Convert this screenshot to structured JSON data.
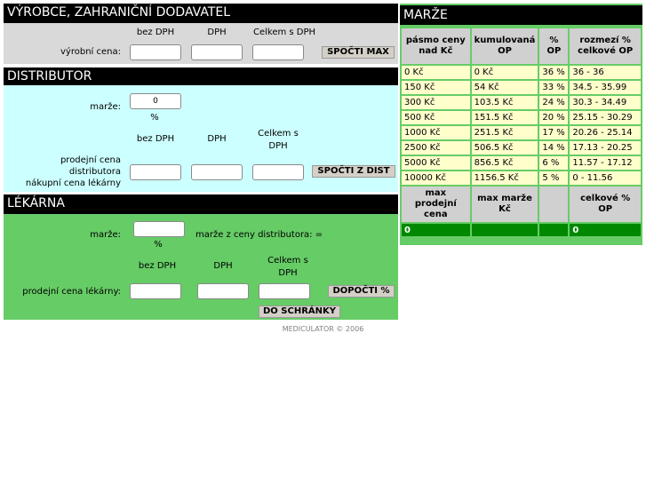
{
  "vyrobce": {
    "title": "VÝROBCE, ZAHRANIČNÍ DODAVATEL",
    "col_bez": "bez DPH",
    "col_dph": "DPH",
    "col_celkem": "Celkem s DPH",
    "row_label": "výrobní cena:",
    "button": "SPOČTI MAX",
    "values": {
      "bez": "",
      "dph": "",
      "celkem": ""
    }
  },
  "distributor": {
    "title": "DISTRIBUTOR",
    "marze_label": "marže:",
    "marze_value": "0",
    "percent": "%",
    "col_bez": "bez DPH",
    "col_dph": "DPH",
    "col_celkem": "Celkem s DPH",
    "row_label_1": "prodejní cena",
    "row_label_2": "distributora",
    "row_label_3": "nákupní cena lékárny",
    "button": "SPOČTI Z DIST",
    "values": {
      "bez": "",
      "dph": "",
      "celkem": ""
    }
  },
  "lekarna": {
    "title": "LÉKÁRNA",
    "marze_label": "marže:",
    "marze_value": "",
    "percent": "%",
    "marze_z_ceny": "marže z ceny distributora: =",
    "col_bez": "bez DPH",
    "col_dph": "DPH",
    "col_celkem": "Celkem s DPH",
    "row_label": "prodejní cena lékárny:",
    "button_dopocti": "DOPOČTI %",
    "button_schranky": "DO SCHRÁNKY",
    "values": {
      "bez": "",
      "dph": "",
      "celkem": ""
    }
  },
  "marze": {
    "title": "MARŽE",
    "headers": [
      "pásmo ceny nad Kč",
      "kumulovaná OP",
      "% OP",
      "rozmezí % celkové OP"
    ],
    "rows": [
      [
        "0 Kč",
        "0 Kč",
        "36 %",
        "36 - 36"
      ],
      [
        "150 Kč",
        "54 Kč",
        "33 %",
        "34.5 - 35.99"
      ],
      [
        "300 Kč",
        "103.5 Kč",
        "24 %",
        "30.3 - 34.49"
      ],
      [
        "500 Kč",
        "151.5 Kč",
        "20 %",
        "25.15 - 30.29"
      ],
      [
        "1000 Kč",
        "251.5 Kč",
        "17 %",
        "20.26 - 25.14"
      ],
      [
        "2500 Kč",
        "506.5 Kč",
        "14 %",
        "17.13 - 20.25"
      ],
      [
        "5000 Kč",
        "856.5 Kč",
        "6 %",
        "11.57 - 17.12"
      ],
      [
        "10000 Kč",
        "1156.5 Kč",
        "5 %",
        "0 - 11.56"
      ]
    ],
    "footer_headers": [
      "max prodejní cena",
      "max marže Kč",
      "",
      "celkové % OP"
    ],
    "footer_values": [
      "0",
      "",
      "",
      "0"
    ]
  },
  "footer": "MEDICULATOR © 2006",
  "colors": {
    "vyrobce_bg": "#d9d9d9",
    "distributor_bg": "#ccffff",
    "lekarna_bg": "#66cc66",
    "marze_bg": "#66cc66",
    "marze_row_bg": "#ffffcc",
    "marze_total_bg": "#008800"
  }
}
